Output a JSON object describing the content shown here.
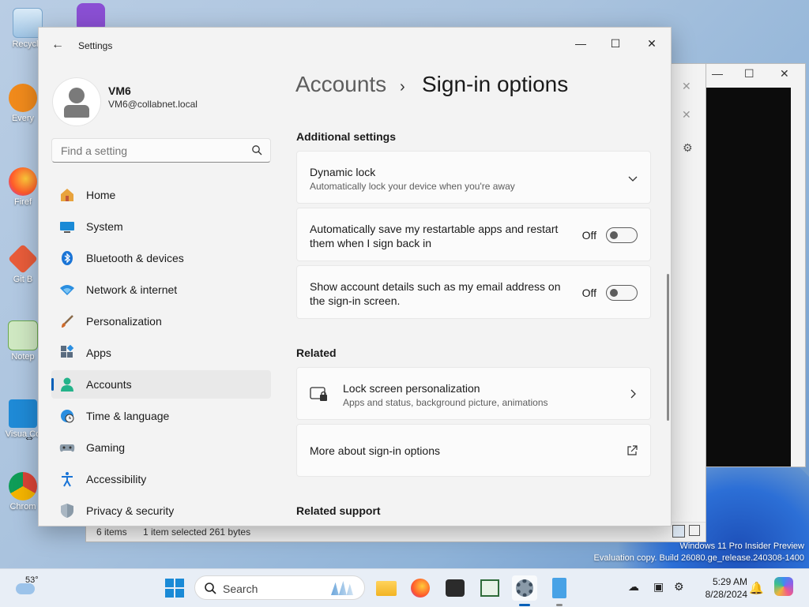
{
  "desktop": {
    "icons": [
      {
        "label": "Recycle"
      },
      {
        "label": "Every"
      },
      {
        "label": "Firef"
      },
      {
        "label": "Git B"
      },
      {
        "label": "Notep"
      },
      {
        "label": "Visua Co"
      },
      {
        "label": "Chrom"
      }
    ],
    "watermark_line1": "Windows 11 Pro Insider Preview",
    "watermark_line2": "Evaluation copy. Build 26080.ge_release.240308-1400"
  },
  "background_explorer": {
    "status_items": "6 items",
    "status_selection": "1 item selected  261 bytes"
  },
  "settings": {
    "window_title": "Settings",
    "user": {
      "name": "VM6",
      "email": "VM6@collabnet.local"
    },
    "search": {
      "placeholder": "Find a setting"
    },
    "nav": [
      {
        "label": "Home",
        "icon": "home-icon"
      },
      {
        "label": "System",
        "icon": "system-icon"
      },
      {
        "label": "Bluetooth & devices",
        "icon": "bluetooth-icon"
      },
      {
        "label": "Network & internet",
        "icon": "network-icon"
      },
      {
        "label": "Personalization",
        "icon": "brush-icon"
      },
      {
        "label": "Apps",
        "icon": "apps-icon"
      },
      {
        "label": "Accounts",
        "icon": "accounts-icon",
        "active": true
      },
      {
        "label": "Time & language",
        "icon": "globe-clock-icon"
      },
      {
        "label": "Gaming",
        "icon": "gamepad-icon"
      },
      {
        "label": "Accessibility",
        "icon": "accessibility-icon"
      },
      {
        "label": "Privacy & security",
        "icon": "shield-icon"
      }
    ],
    "breadcrumb": {
      "parent": "Accounts",
      "separator": "›",
      "current": "Sign-in options"
    },
    "additional_settings": {
      "heading": "Additional settings",
      "dynamic_lock": {
        "title": "Dynamic lock",
        "subtitle": "Automatically lock your device when you're away"
      },
      "restart_apps": {
        "title_line1": "Automatically save my restartable apps and restart",
        "title_line2": "them when I sign back in",
        "state": "Off"
      },
      "account_details": {
        "title_line1": "Show account details such as my email address on",
        "title_line2": "the sign-in screen.",
        "state": "Off"
      }
    },
    "related": {
      "heading": "Related",
      "lock_screen": {
        "title": "Lock screen personalization",
        "subtitle": "Apps and status, background picture, animations"
      },
      "more_about": {
        "title": "More about sign-in options"
      }
    },
    "related_support": {
      "heading": "Related support"
    }
  },
  "taskbar": {
    "weather_temp": "53°",
    "search_label": "Search",
    "time": "5:29 AM",
    "date": "8/28/2024"
  },
  "colors": {
    "accent": "#005fb8",
    "window_bg": "#f3f3f3",
    "card_bg": "#fbfbfb"
  }
}
